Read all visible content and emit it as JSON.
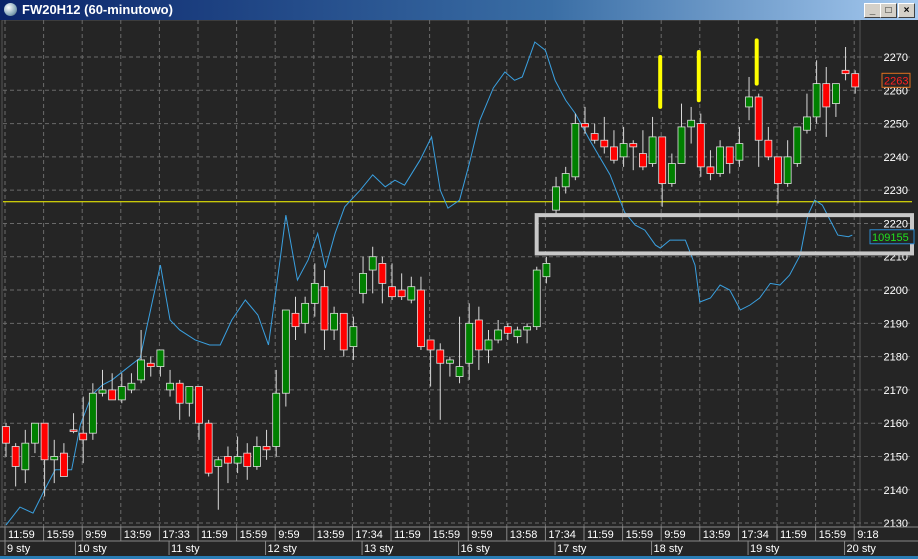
{
  "window": {
    "title": "FW20H12 (60-minutowo)",
    "minimize": "_",
    "maximize": "□",
    "close": "×"
  },
  "chart_data": {
    "type": "candlestick",
    "symbol": "FW20H12",
    "interval": "60-minutowo",
    "ylim": [
      2127,
      2280
    ],
    "y_ticks": [
      2130,
      2140,
      2150,
      2160,
      2170,
      2180,
      2190,
      2200,
      2210,
      2220,
      2230,
      2240,
      2250,
      2260,
      2270
    ],
    "current_price_label": "2263",
    "indicator_label": "109155",
    "horizontal_line": 2226.5,
    "highlight_box": {
      "from_candle": 55.2,
      "price_top": 2222.5,
      "price_bottom": 2211
    },
    "yellow_marks": [
      {
        "candle": 68,
        "top": 2270,
        "bottom": 2255
      },
      {
        "candle": 72,
        "top": 2271.5,
        "bottom": 2257
      },
      {
        "candle": 78,
        "top": 2275,
        "bottom": 2262
      }
    ],
    "time_labels": [
      "11:59",
      "15:59",
      "9:59",
      "13:59",
      "17:33",
      "11:59",
      "15:59",
      "9:59",
      "13:59",
      "17:34",
      "11:59",
      "15:59",
      "9:59",
      "13:58",
      "17:34",
      "11:59",
      "15:59",
      "9:59",
      "13:59",
      "17:34",
      "11:59",
      "15:59",
      "9:18"
    ],
    "date_labels": [
      {
        "candle": 0,
        "label": "9 sty"
      },
      {
        "candle": 7.3,
        "label": "10 sty"
      },
      {
        "candle": 17,
        "label": "11 sty"
      },
      {
        "candle": 27,
        "label": "12 sty"
      },
      {
        "candle": 37,
        "label": "13 sty"
      },
      {
        "candle": 47,
        "label": "16 sty"
      },
      {
        "candle": 57,
        "label": "17 sty"
      },
      {
        "candle": 67,
        "label": "18 sty"
      },
      {
        "candle": 77,
        "label": "19 sty"
      },
      {
        "candle": 87,
        "label": "20 sty"
      }
    ],
    "colors": {
      "up": "#008000",
      "down": "#ff0000",
      "indicator": "#3aa0e0",
      "hline": "#ffff00",
      "box": "#c8c8c8",
      "mark": "#ffff00"
    },
    "candles_ohlc": [
      [
        2159,
        2160,
        2150,
        2154
      ],
      [
        2153,
        2154,
        2141,
        2147
      ],
      [
        2146,
        2158,
        2142,
        2154
      ],
      [
        2154,
        2160,
        2151,
        2160
      ],
      [
        2160,
        2160,
        2138,
        2149
      ],
      [
        2149,
        2155,
        2142,
        2150
      ],
      [
        2151,
        2154,
        2144,
        2144
      ],
      [
        2158,
        2163,
        2157,
        2157.5
      ],
      [
        2157,
        2168,
        2148,
        2155
      ],
      [
        2157,
        2172,
        2155,
        2169
      ],
      [
        2169,
        2176,
        2168,
        2170
      ],
      [
        2170,
        2175,
        2167,
        2167
      ],
      [
        2167,
        2175,
        2166,
        2171
      ],
      [
        2170,
        2175,
        2169,
        2172
      ],
      [
        2173,
        2188,
        2172,
        2179
      ],
      [
        2178,
        2180,
        2174,
        2177
      ],
      [
        2177,
        2182,
        2174,
        2182
      ],
      [
        2170,
        2176,
        2168,
        2172
      ],
      [
        2172,
        2173,
        2161,
        2166
      ],
      [
        2166,
        2171,
        2162,
        2171
      ],
      [
        2171,
        2171,
        2155,
        2160
      ],
      [
        2160,
        2161,
        2144,
        2145
      ],
      [
        2147,
        2150,
        2134,
        2149
      ],
      [
        2150,
        2153,
        2142,
        2148
      ],
      [
        2148,
        2156,
        2145,
        2150
      ],
      [
        2151,
        2154,
        2143,
        2147
      ],
      [
        2147,
        2156,
        2146,
        2153
      ],
      [
        2153,
        2158,
        2149,
        2152
      ],
      [
        2153,
        2176,
        2150,
        2169
      ],
      [
        2169,
        2194,
        2165,
        2194
      ],
      [
        2193,
        2198,
        2185,
        2189
      ],
      [
        2190,
        2198,
        2187,
        2196
      ],
      [
        2196,
        2208,
        2192,
        2202
      ],
      [
        2201,
        2206,
        2182,
        2188
      ],
      [
        2188,
        2195,
        2185,
        2193
      ],
      [
        2193,
        2193,
        2180,
        2182
      ],
      [
        2183,
        2192,
        2179,
        2189
      ],
      [
        2199,
        2210,
        2196,
        2205
      ],
      [
        2206,
        2213,
        2199,
        2210
      ],
      [
        2208,
        2210,
        2196,
        2202
      ],
      [
        2201,
        2208,
        2197,
        2198
      ],
      [
        2200,
        2205,
        2197,
        2198
      ],
      [
        2197,
        2204,
        2196,
        2201
      ],
      [
        2200,
        2204,
        2182,
        2183
      ],
      [
        2185,
        2185,
        2171,
        2182
      ],
      [
        2182,
        2184,
        2161,
        2178
      ],
      [
        2178,
        2180,
        2174,
        2179
      ],
      [
        2174,
        2192,
        2172,
        2177
      ],
      [
        2178,
        2196,
        2173,
        2190
      ],
      [
        2191,
        2195,
        2176,
        2182
      ],
      [
        2182,
        2188,
        2178,
        2185
      ],
      [
        2185,
        2191,
        2184,
        2188
      ],
      [
        2189,
        2190,
        2185,
        2187
      ],
      [
        2186,
        2189,
        2184,
        2188
      ],
      [
        2188,
        2190,
        2184,
        2189
      ],
      [
        2189,
        2207,
        2188,
        2206
      ],
      [
        2204,
        2210,
        2202,
        2208
      ],
      [
        2224,
        2234,
        2223,
        2231
      ],
      [
        2231,
        2237,
        2229,
        2235
      ],
      [
        2234,
        2253,
        2233,
        2250
      ],
      [
        2250,
        2255,
        2247,
        2249
      ],
      [
        2247,
        2250,
        2244,
        2245
      ],
      [
        2245,
        2252,
        2241,
        2243
      ],
      [
        2243,
        2248,
        2238,
        2239
      ],
      [
        2240,
        2249,
        2237,
        2244
      ],
      [
        2244,
        2245,
        2236,
        2243
      ],
      [
        2241,
        2248,
        2236,
        2237
      ],
      [
        2238,
        2252,
        2237,
        2246
      ],
      [
        2246,
        2246,
        2225,
        2232
      ],
      [
        2232,
        2241,
        2231,
        2238
      ],
      [
        2238,
        2256,
        2238,
        2249
      ],
      [
        2249,
        2255,
        2244,
        2251
      ],
      [
        2250,
        2253,
        2234,
        2237
      ],
      [
        2237,
        2242,
        2233,
        2235
      ],
      [
        2235,
        2245,
        2234,
        2243
      ],
      [
        2243,
        2243,
        2235,
        2238
      ],
      [
        2239,
        2249,
        2237,
        2244
      ],
      [
        2255,
        2264,
        2251,
        2258
      ],
      [
        2258,
        2259,
        2237,
        2245
      ],
      [
        2245,
        2249,
        2239,
        2240
      ],
      [
        2240,
        2240,
        2226,
        2232
      ],
      [
        2232,
        2245,
        2231,
        2240
      ],
      [
        2238,
        2249,
        2237,
        2249
      ],
      [
        2248,
        2259,
        2247,
        2252
      ],
      [
        2252,
        2269,
        2250,
        2262
      ],
      [
        2262,
        2267,
        2246,
        2255
      ],
      [
        2256,
        2262,
        2252,
        2262
      ],
      [
        2266,
        2273,
        2263,
        2265
      ],
      [
        2265,
        2266,
        2259,
        2261
      ]
    ],
    "indicator": [
      [
        0,
        2129.4
      ],
      [
        1.45,
        2134.8
      ],
      [
        2.8,
        2133
      ],
      [
        4,
        2140
      ],
      [
        5.1,
        2146
      ],
      [
        6.8,
        2146
      ],
      [
        7.7,
        2159.5
      ],
      [
        8.9,
        2168.5
      ],
      [
        10,
        2171.5
      ],
      [
        11,
        2173
      ],
      [
        12.3,
        2176
      ],
      [
        13.9,
        2179.6
      ],
      [
        15.2,
        2197
      ],
      [
        16,
        2207.5
      ],
      [
        17,
        2191
      ],
      [
        18,
        2188
      ],
      [
        19.6,
        2185
      ],
      [
        21.1,
        2183.5
      ],
      [
        22.2,
        2183.5
      ],
      [
        23.4,
        2191
      ],
      [
        24.8,
        2197
      ],
      [
        26.1,
        2192.5
      ],
      [
        27.2,
        2183.5
      ],
      [
        28.4,
        2209
      ],
      [
        29,
        2222.5
      ],
      [
        30.2,
        2203
      ],
      [
        31.3,
        2209
      ],
      [
        32.3,
        2217
      ],
      [
        33.1,
        2206.6
      ],
      [
        34.1,
        2217
      ],
      [
        35.1,
        2225
      ],
      [
        36.7,
        2230
      ],
      [
        38,
        2234.6
      ],
      [
        39.3,
        2231
      ],
      [
        40.3,
        2233
      ],
      [
        41.3,
        2231.5
      ],
      [
        42.9,
        2239
      ],
      [
        44.1,
        2246
      ],
      [
        45,
        2230
      ],
      [
        45.8,
        2224.6
      ],
      [
        47,
        2227
      ],
      [
        48.1,
        2239
      ],
      [
        49.1,
        2251
      ],
      [
        50.5,
        2260.7
      ],
      [
        51.7,
        2265.5
      ],
      [
        52.7,
        2263
      ],
      [
        53.5,
        2264
      ],
      [
        54.8,
        2274.5
      ],
      [
        55.9,
        2272
      ],
      [
        56.9,
        2263
      ],
      [
        58,
        2257
      ],
      [
        59,
        2253
      ],
      [
        60.5,
        2245
      ],
      [
        62.6,
        2234.6
      ],
      [
        64.1,
        2223.4
      ],
      [
        65.2,
        2219.5
      ],
      [
        66.2,
        2218
      ],
      [
        67.3,
        2213.5
      ],
      [
        67.8,
        2212.6
      ],
      [
        68.8,
        2215
      ],
      [
        70.4,
        2215
      ],
      [
        71.4,
        2207.5
      ],
      [
        71.9,
        2196.4
      ],
      [
        73,
        2197.6
      ],
      [
        74,
        2201.5
      ],
      [
        75,
        2200
      ],
      [
        76.1,
        2194
      ],
      [
        77.1,
        2195.5
      ],
      [
        78.1,
        2197.6
      ],
      [
        79.2,
        2202
      ],
      [
        80.2,
        2201.5
      ],
      [
        81.2,
        2204.5
      ],
      [
        82.3,
        2210.5
      ],
      [
        83.1,
        2222.5
      ],
      [
        83.8,
        2227
      ],
      [
        84.6,
        2225.5
      ],
      [
        85.4,
        2221
      ],
      [
        86.2,
        2216.5
      ],
      [
        87.3,
        2216
      ],
      [
        87.7,
        2216.5
      ]
    ]
  }
}
